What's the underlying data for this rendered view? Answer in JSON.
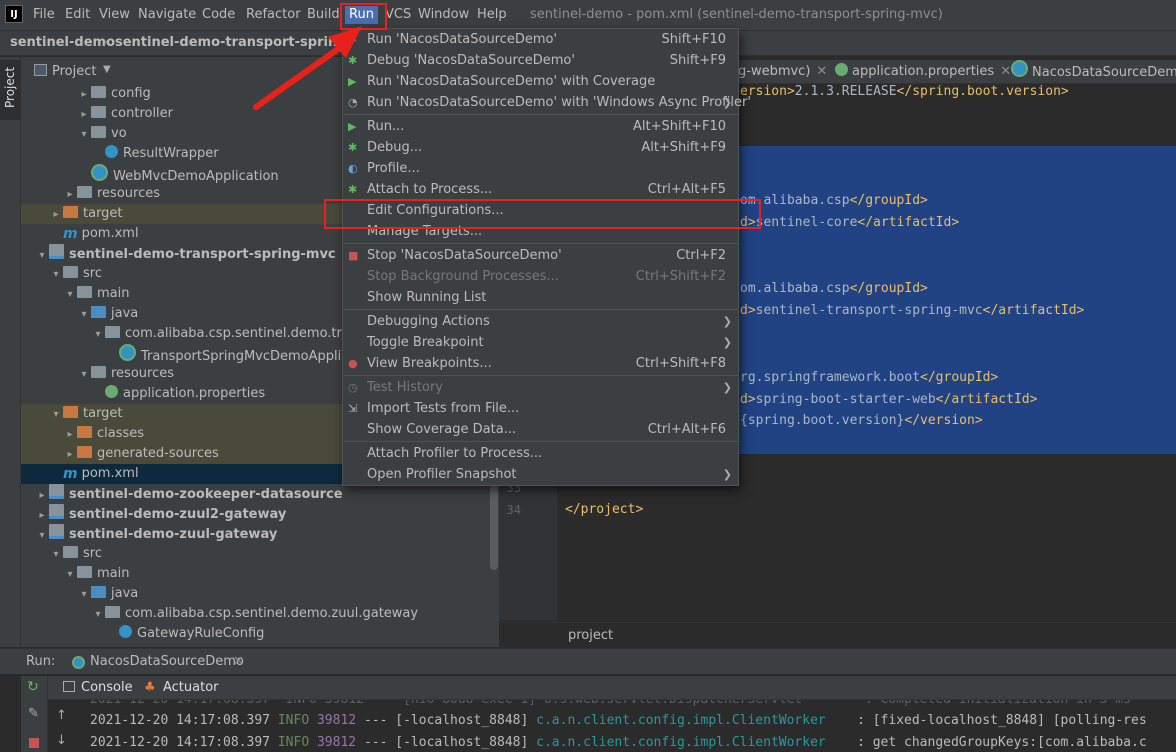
{
  "menubar": {
    "items": [
      "File",
      "Edit",
      "View",
      "Navigate",
      "Code",
      "Refactor",
      "Build",
      "Run",
      "VCS",
      "Window",
      "Help"
    ],
    "window_title": "sentinel-demo - pom.xml (sentinel-demo-transport-spring-mvc)"
  },
  "navbar": {
    "crumbs": [
      "sentinel-demo",
      "sentinel-demo-transport-spring-mvc"
    ]
  },
  "project": {
    "strip_label": "Project",
    "header": "Project",
    "tree": [
      {
        "label": "config",
        "indent": 3,
        "arrow": "▸",
        "icon": "folder"
      },
      {
        "label": "controller",
        "indent": 3,
        "arrow": "▸",
        "icon": "folder"
      },
      {
        "label": "vo",
        "indent": 3,
        "arrow": "▾",
        "icon": "folder"
      },
      {
        "label": "ResultWrapper",
        "indent": 4,
        "arrow": "",
        "icon": "cls"
      },
      {
        "label": "WebMvcDemoApplication",
        "indent": 3,
        "arrow": "",
        "icon": "spring"
      },
      {
        "label": "resources",
        "indent": 2,
        "arrow": "▸",
        "icon": "folder"
      },
      {
        "label": "target",
        "indent": 1,
        "arrow": "▸",
        "icon": "folder-orange",
        "hl": "y"
      },
      {
        "label": "pom.xml",
        "indent": 1,
        "arrow": "",
        "icon": "pom"
      },
      {
        "label": "sentinel-demo-transport-spring-mvc",
        "indent": 0,
        "arrow": "▾",
        "icon": "mod",
        "bold": true
      },
      {
        "label": "src",
        "indent": 1,
        "arrow": "▾",
        "icon": "folder"
      },
      {
        "label": "main",
        "indent": 2,
        "arrow": "▾",
        "icon": "folder"
      },
      {
        "label": "java",
        "indent": 3,
        "arrow": "▾",
        "icon": "folder-blue"
      },
      {
        "label": "com.alibaba.csp.sentinel.demo.transport.sp",
        "indent": 4,
        "arrow": "▾",
        "icon": "folder"
      },
      {
        "label": "TransportSpringMvcDemoApplication",
        "indent": 5,
        "arrow": "",
        "icon": "spring"
      },
      {
        "label": "resources",
        "indent": 3,
        "arrow": "▾",
        "icon": "folder"
      },
      {
        "label": "application.properties",
        "indent": 4,
        "arrow": "",
        "icon": "prop"
      },
      {
        "label": "target",
        "indent": 1,
        "arrow": "▾",
        "icon": "folder-orange",
        "hl": "y"
      },
      {
        "label": "classes",
        "indent": 2,
        "arrow": "▸",
        "icon": "folder-orange",
        "hl": "y"
      },
      {
        "label": "generated-sources",
        "indent": 2,
        "arrow": "▸",
        "icon": "folder-orange",
        "hl": "y"
      },
      {
        "label": "pom.xml",
        "indent": 1,
        "arrow": "",
        "icon": "pom",
        "hl": "sel"
      },
      {
        "label": "sentinel-demo-zookeeper-datasource",
        "indent": 0,
        "arrow": "▸",
        "icon": "mod",
        "bold": true
      },
      {
        "label": "sentinel-demo-zuul2-gateway",
        "indent": 0,
        "arrow": "▸",
        "icon": "mod",
        "bold": true
      },
      {
        "label": "sentinel-demo-zuul-gateway",
        "indent": 0,
        "arrow": "▾",
        "icon": "mod",
        "bold": true
      },
      {
        "label": "src",
        "indent": 1,
        "arrow": "▾",
        "icon": "folder"
      },
      {
        "label": "main",
        "indent": 2,
        "arrow": "▾",
        "icon": "folder"
      },
      {
        "label": "java",
        "indent": 3,
        "arrow": "▾",
        "icon": "folder-blue"
      },
      {
        "label": "com.alibaba.csp.sentinel.demo.zuul.gateway",
        "indent": 4,
        "arrow": "▾",
        "icon": "folder"
      },
      {
        "label": "GatewayRuleConfig",
        "indent": 5,
        "arrow": "",
        "icon": "cls"
      }
    ]
  },
  "editor": {
    "tabs": [
      {
        "label": "g-webmvc)",
        "icon": ""
      },
      {
        "label": "application.properties",
        "icon": "prop"
      },
      {
        "label": "NacosDataSourceDemo.ja",
        "icon": "spring"
      }
    ],
    "line_numbers": [
      "33",
      "34"
    ],
    "code": [
      {
        "pre": "",
        "open": "ersion>",
        "text": "2.1.3.RELEASE",
        "close": "</spring.boot.version>"
      },
      {
        "pre": "",
        "open": "om",
        "text": ".alibaba.csp",
        "close": "</groupId>"
      },
      {
        "pre": "",
        "open": "d>",
        "text": "sentinel-core",
        "close": "</artifactId>"
      },
      {
        "pre": "",
        "open": "om",
        "text": ".alibaba.csp",
        "close": "</groupId>"
      },
      {
        "pre": "",
        "open": "d>",
        "text": "sentinel-transport-spring-mvc",
        "close": "</artifactId>"
      },
      {
        "pre": "",
        "open": "rg",
        "text": ".springframework.boot",
        "close": "</groupId>"
      },
      {
        "pre": "",
        "open": "d>",
        "text": "spring-boot-starter-web",
        "close": "</artifactId>"
      },
      {
        "pre": "",
        "open": "{",
        "text": "spring.boot.version}",
        "close": "</version>"
      },
      {
        "pre": "",
        "open": "</project>",
        "text": "",
        "close": ""
      }
    ],
    "bottom_breadcrumb": "project"
  },
  "run": {
    "label": "Run:",
    "config": "NacosDataSourceDemo",
    "tabs": [
      "Console",
      "Actuator"
    ],
    "log": [
      {
        "date": "2021-12-20 14:17:08.397",
        "level": "INFO",
        "pid": "39812",
        "sep": "---",
        "thread": "[-localhost_8848]",
        "cls": "c.a.n.client.config.impl.ClientWorker",
        "msg": ": [fixed-localhost_8848] [polling-res"
      },
      {
        "date": "2021-12-20 14:17:08.397",
        "level": "INFO",
        "pid": "39812",
        "sep": "---",
        "thread": "[-localhost_8848]",
        "cls": "c.a.n.client.config.impl.ClientWorker",
        "msg": ": get changedGroupKeys:[com.alibaba.c"
      }
    ]
  },
  "run_menu": {
    "items": [
      {
        "label": "Run 'NacosDataSourceDemo'",
        "shortcut": "Shift+F10",
        "icon": "run-icon"
      },
      {
        "label": "Debug 'NacosDataSourceDemo'",
        "shortcut": "Shift+F9",
        "icon": "debug-icon"
      },
      {
        "label": "Run 'NacosDataSourceDemo' with Coverage",
        "shortcut": "",
        "icon": "coverage-icon"
      },
      {
        "label": "Run 'NacosDataSourceDemo' with 'Windows Async Profiler'",
        "shortcut": "",
        "icon": "profiler-icon",
        "sub": true
      },
      {
        "sep": true
      },
      {
        "label": "Run...",
        "shortcut": "Alt+Shift+F10",
        "icon": "run-icon"
      },
      {
        "label": "Debug...",
        "shortcut": "Alt+Shift+F9",
        "icon": "debug-icon"
      },
      {
        "label": "Profile...",
        "shortcut": "",
        "icon": "profile-icon"
      },
      {
        "label": "Attach to Process...",
        "shortcut": "Ctrl+Alt+F5",
        "icon": "attach-icon"
      },
      {
        "label": "Edit Configurations...",
        "shortcut": "",
        "icon": ""
      },
      {
        "label": "Manage Targets...",
        "shortcut": "",
        "icon": ""
      },
      {
        "sep": true
      },
      {
        "label": "Stop 'NacosDataSourceDemo'",
        "shortcut": "Ctrl+F2",
        "icon": "stop-icon"
      },
      {
        "label": "Stop Background Processes...",
        "shortcut": "Ctrl+Shift+F2",
        "icon": "",
        "disabled": true
      },
      {
        "label": "Show Running List",
        "shortcut": "",
        "icon": ""
      },
      {
        "sep": true
      },
      {
        "label": "Debugging Actions",
        "shortcut": "",
        "icon": "",
        "sub": true
      },
      {
        "label": "Toggle Breakpoint",
        "shortcut": "",
        "icon": "",
        "sub": true
      },
      {
        "label": "View Breakpoints...",
        "shortcut": "Ctrl+Shift+F8",
        "icon": "breakpoints-icon"
      },
      {
        "sep": true
      },
      {
        "label": "Test History",
        "shortcut": "",
        "icon": "history-icon",
        "disabled": true,
        "sub": true
      },
      {
        "label": "Import Tests from File...",
        "shortcut": "",
        "icon": "import-icon"
      },
      {
        "label": "Show Coverage Data...",
        "shortcut": "Ctrl+Alt+F6",
        "icon": ""
      },
      {
        "sep": true
      },
      {
        "label": "Attach Profiler to Process...",
        "shortcut": "",
        "icon": ""
      },
      {
        "label": "Open Profiler Snapshot",
        "shortcut": "",
        "icon": "",
        "sub": true
      }
    ]
  },
  "colors": {
    "accent": "#4b6eaf",
    "annotation": "#e8221a",
    "selection": "#214283"
  }
}
